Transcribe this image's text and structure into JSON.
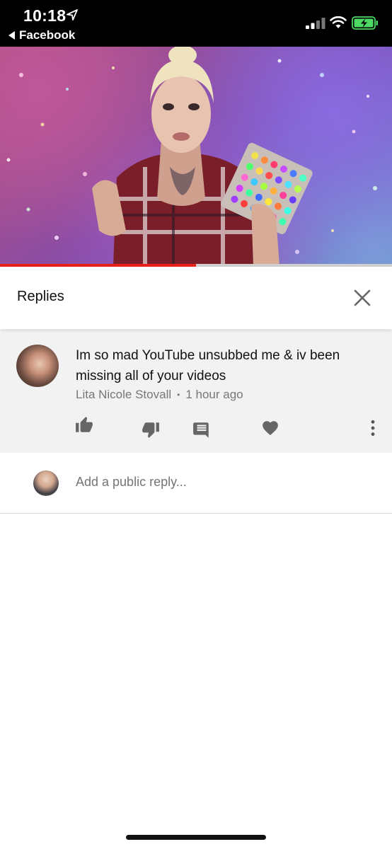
{
  "status_bar": {
    "time": "10:18",
    "back_app": "Facebook"
  },
  "video": {
    "progress": 0.5
  },
  "replies": {
    "title": "Replies"
  },
  "comment": {
    "text": "Im so mad YouTube unsubbed me & iv been missing all of your videos",
    "author": "Lita Nicole Stovall",
    "separator": "•",
    "time": "1 hour ago"
  },
  "reply_box": {
    "placeholder": "Add a public reply..."
  },
  "colors": {
    "progress": "#e62117",
    "icon_gray": "#666666",
    "comment_bg": "#f2f2f2"
  }
}
